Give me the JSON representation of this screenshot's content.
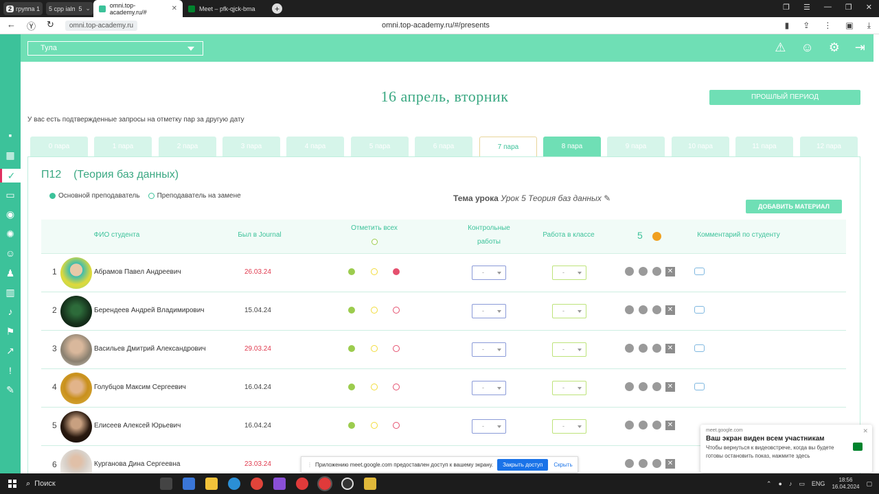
{
  "browser": {
    "tab_group": {
      "count": "2",
      "label": "группа 1",
      "count2": "5",
      "label2": "срр іаlп",
      "count3": "5"
    },
    "tabs": [
      {
        "title": "omni.top-academy.ru/#",
        "active": true
      },
      {
        "title": "Meet – pfk-qjck-bma",
        "active": false
      }
    ],
    "url_chip": "omni.top-academy.ru",
    "url": "omni.top-academy.ru/#/presents"
  },
  "header": {
    "city": "Тула"
  },
  "page": {
    "date_title": "16 апрель, вторник",
    "past_period_button": "ПРОШЛЫЙ ПЕРИОД",
    "notice": "У вас есть подтвержденные запросы на отметку пар за другую дату",
    "pairs": [
      "0 пара",
      "1 пара",
      "2 пара",
      "3 пара",
      "4 пара",
      "5 пара",
      "6 пара",
      "7 пара",
      "8 пара",
      "9 пара",
      "10 пара",
      "11 пара",
      "12 пара"
    ],
    "group_code": "П12",
    "group_subject": "(Теория баз данных)",
    "legend_main": "Основной преподаватель",
    "legend_sub": "Преподаватель на замене",
    "topic_label": "Тема урока",
    "topic_value": "Урок 5 Теория баз данных",
    "add_material": "ДОБАВИТЬ МАТЕРИАЛ"
  },
  "table": {
    "col_name": "ФИО студента",
    "col_journal": "Был в Journal",
    "col_mark_all": "Отметить всех",
    "col_control_1": "Контрольные",
    "col_control_2": "работы",
    "col_classwork": "Работа в классе",
    "col_coins": "5",
    "col_comment": "Комментарий по студенту",
    "rows": [
      {
        "num": "1",
        "name": "Абрамов Павел Андреевич",
        "date": "26.03.24",
        "date_red": true,
        "status": "absent",
        "control": "-",
        "classwork": "-"
      },
      {
        "num": "2",
        "name": "Берендеев Андрей Владимирович",
        "date": "15.04.24",
        "date_red": false,
        "status": "none",
        "control": "-",
        "classwork": "-"
      },
      {
        "num": "3",
        "name": "Васильев Дмитрий Александрович",
        "date": "29.03.24",
        "date_red": true,
        "status": "none",
        "control": "-",
        "classwork": "-"
      },
      {
        "num": "4",
        "name": "Голубцов Максим Сергеевич",
        "date": "16.04.24",
        "date_red": false,
        "status": "none",
        "control": "-",
        "classwork": "-"
      },
      {
        "num": "5",
        "name": "Елисеев Алексей Юрьевич",
        "date": "16.04.24",
        "date_red": false,
        "status": "none",
        "control": "-",
        "classwork": "-"
      },
      {
        "num": "6",
        "name": "Курганова Дина Сергеевна",
        "date": "23.03.24",
        "date_red": true,
        "status": "none",
        "control": "-",
        "classwork": "-"
      }
    ]
  },
  "share_bar": {
    "text": "Приложению meet.google.com предоставлен доступ к вашему экрану.",
    "stop": "Закрыть доступ",
    "hide": "Скрыть"
  },
  "toast": {
    "source": "meet.google.com",
    "title": "Ваш экран виден всем участникам",
    "message": "Чтобы вернуться к видеовстрече, когда вы будете готовы остановить показ, нажмите здесь"
  },
  "taskbar": {
    "search": "Поиск",
    "lang": "ENG",
    "time": "18:56",
    "date": "16.04.2024"
  },
  "colors": {
    "brand": "#3cc29a",
    "header": "#6fdfb5",
    "present": "#9ccc4e",
    "late": "#f2dc3a",
    "absent": "#e5506e"
  }
}
